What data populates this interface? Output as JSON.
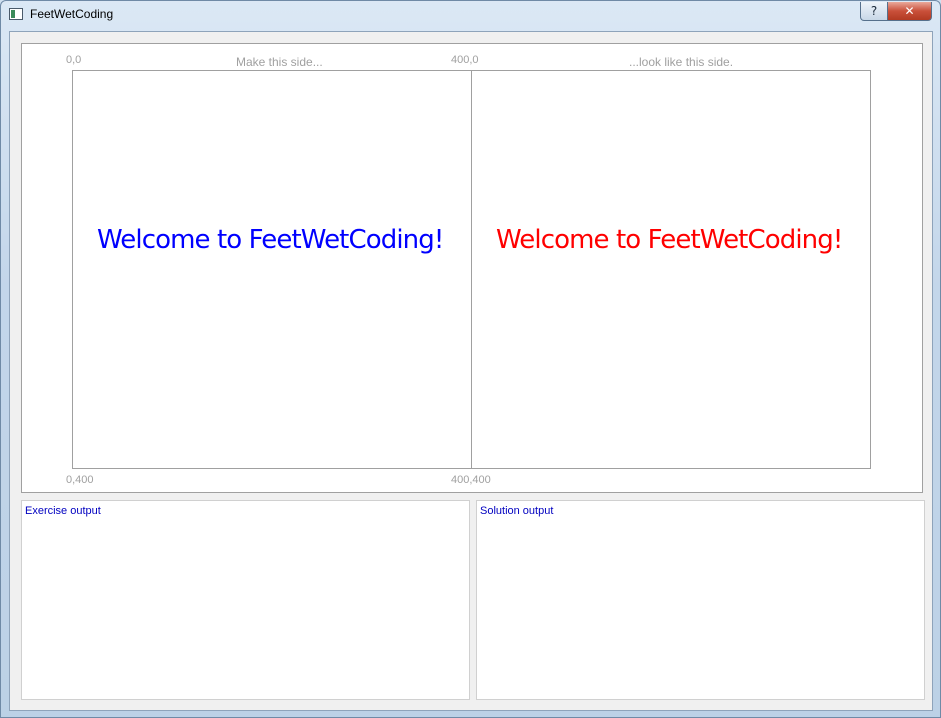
{
  "window": {
    "title": "FeetWetCoding",
    "help_label": "?",
    "close_label": "✕",
    "icon": "app-window-icon"
  },
  "canvas": {
    "captions": {
      "left": "Make this side...",
      "right": "...look like this side."
    },
    "coords": {
      "top_left": "0,0",
      "top_mid": "400,0",
      "bottom_left": "0,400",
      "bottom_mid": "400,400"
    },
    "exercise_text": "Welcome to FeetWetCoding!",
    "solution_text": "Welcome to FeetWetCoding!",
    "colors": {
      "exercise_text": "#0000ff",
      "solution_text": "#ff0000"
    }
  },
  "outputs": {
    "exercise_label": "Exercise output",
    "solution_label": "Solution output"
  }
}
